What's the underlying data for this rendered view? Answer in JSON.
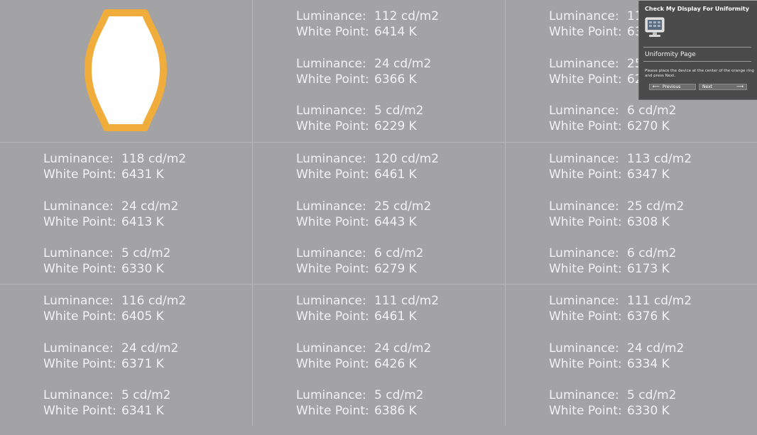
{
  "labels": {
    "luminance": "Luminance:",
    "white_point": "White Point:"
  },
  "grid": [
    [
      {
        "target": true,
        "readings": []
      },
      {
        "readings": [
          {
            "lum": "112 cd/m2",
            "wp": "6414 K"
          },
          {
            "lum": "24 cd/m2",
            "wp": "6366 K"
          },
          {
            "lum": "5 cd/m2",
            "wp": "6229 K"
          }
        ]
      },
      {
        "readings": [
          {
            "lum": "11",
            "wp": "63"
          },
          {
            "lum": "25",
            "wp": "62"
          },
          {
            "lum": "6 cd/m2",
            "wp": "6270 K"
          }
        ]
      }
    ],
    [
      {
        "readings": [
          {
            "lum": "118 cd/m2",
            "wp": "6431 K"
          },
          {
            "lum": "24 cd/m2",
            "wp": "6413 K"
          },
          {
            "lum": "5 cd/m2",
            "wp": "6330 K"
          }
        ]
      },
      {
        "readings": [
          {
            "lum": "120 cd/m2",
            "wp": "6461 K"
          },
          {
            "lum": "25 cd/m2",
            "wp": "6443 K"
          },
          {
            "lum": "6 cd/m2",
            "wp": "6279 K"
          }
        ]
      },
      {
        "readings": [
          {
            "lum": "113 cd/m2",
            "wp": "6347 K"
          },
          {
            "lum": "25 cd/m2",
            "wp": "6308 K"
          },
          {
            "lum": "6 cd/m2",
            "wp": "6173 K"
          }
        ]
      }
    ],
    [
      {
        "readings": [
          {
            "lum": "116 cd/m2",
            "wp": "6405 K"
          },
          {
            "lum": "24 cd/m2",
            "wp": "6371 K"
          },
          {
            "lum": "5 cd/m2",
            "wp": "6341 K"
          }
        ]
      },
      {
        "readings": [
          {
            "lum": "111 cd/m2",
            "wp": "6461 K"
          },
          {
            "lum": "24 cd/m2",
            "wp": "6426 K"
          },
          {
            "lum": "5 cd/m2",
            "wp": "6386 K"
          }
        ]
      },
      {
        "readings": [
          {
            "lum": "111 cd/m2",
            "wp": "6376 K"
          },
          {
            "lum": "24 cd/m2",
            "wp": "6334 K"
          },
          {
            "lum": "5 cd/m2",
            "wp": "6330 K"
          }
        ]
      }
    ]
  ],
  "panel": {
    "title": "Check My Display For Uniformity",
    "subtitle": "Uniformity Page",
    "instructions": "Please place the device at the center of the orange ring and press Next.",
    "prev_label": "Previous",
    "next_label": "Next"
  },
  "colors": {
    "background": "#a3a2a5",
    "ring": "#f0ad3b",
    "text": "#f2f2f2",
    "panel": "#4b4b4b"
  },
  "icons": {
    "monitor": "monitor-icon",
    "target": "orange-ring-target-icon",
    "prev": "arrow-left-icon",
    "next": "arrow-right-icon"
  }
}
